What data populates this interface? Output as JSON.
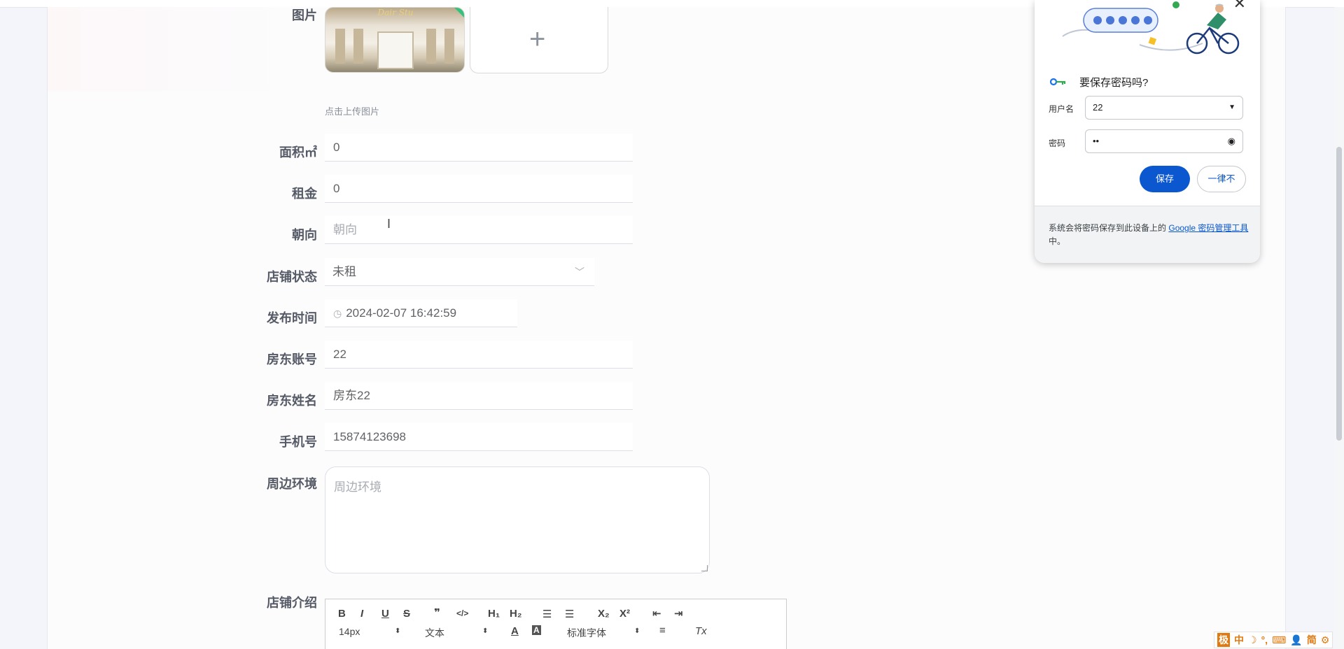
{
  "form": {
    "image_label": "图片",
    "upload_hint": "点击上传图片",
    "thumb_sign": "Dair Stu",
    "area_label": "面积㎡",
    "area_value": "0",
    "rent_label": "租金",
    "rent_value": "0",
    "orientation_label": "朝向",
    "orientation_placeholder": "朝向",
    "status_label": "店铺状态",
    "status_value": "未租",
    "publish_label": "发布时间",
    "publish_value": "2024-02-07 16:42:59",
    "landlord_account_label": "房东账号",
    "landlord_account_value": "22",
    "landlord_name_label": "房东姓名",
    "landlord_name_value": "房东22",
    "phone_label": "手机号",
    "phone_value": "15874123698",
    "surroundings_label": "周边环境",
    "surroundings_placeholder": "周边环境",
    "intro_label": "店铺介绍"
  },
  "editor": {
    "bold": "B",
    "italic": "I",
    "underline": "U",
    "strike": "S",
    "quote": "❞",
    "code": "</>",
    "h1": "H₁",
    "h2": "H₂",
    "ordered_list": "☰",
    "bullet_list": "☰",
    "subscript": "X₂",
    "superscript": "X²",
    "outdent": "⇤",
    "indent": "⇥",
    "size_value": "14px",
    "paragraph_value": "文本",
    "font_color": "A",
    "background_color": "A",
    "font_value": "标准字体",
    "align": "≡",
    "clear_format": "Tx"
  },
  "password_popup": {
    "title": "要保存密码吗?",
    "username_label": "用户名",
    "username_value": "22",
    "password_label": "密码",
    "password_value": "••",
    "save_button": "保存",
    "never_button": "一律不",
    "footer_text": "系统会将密码保存到此设备上的",
    "footer_link": "Google 密码管理工具",
    "footer_suffix": "中。",
    "close": "✕",
    "accent": "#0b57d0"
  },
  "ime": {
    "items": [
      "极",
      "中",
      "☽",
      "°,",
      "⌨",
      "👤",
      "简",
      "⚙"
    ]
  }
}
